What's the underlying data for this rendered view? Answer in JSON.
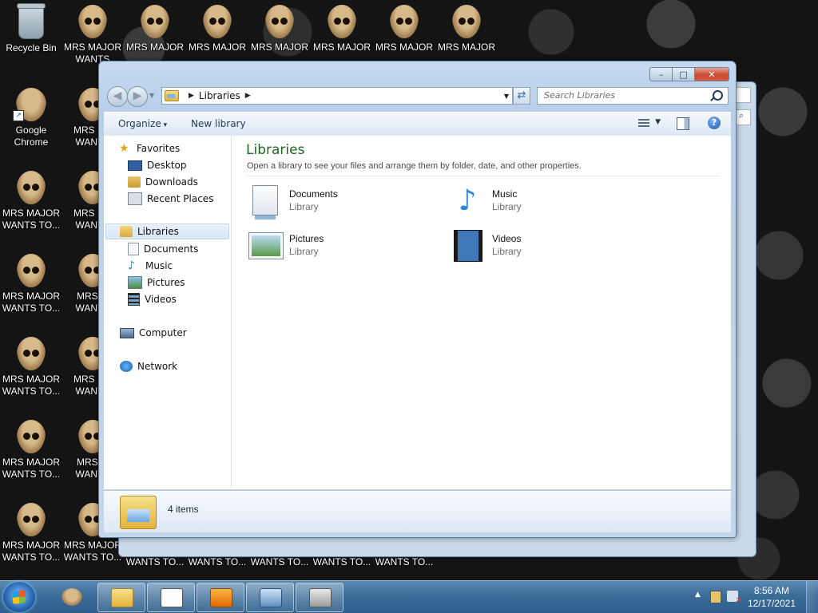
{
  "desktop": {
    "icons": [
      {
        "label": "Recycle Bin",
        "kind": "recycle-bin"
      },
      {
        "label": "MRS MAJOR WANTS...",
        "kind": "skull"
      },
      {
        "label": "MRS MAJOR",
        "kind": "skull"
      },
      {
        "label": "MRS MAJOR",
        "kind": "skull"
      },
      {
        "label": "MRS MAJOR",
        "kind": "skull"
      },
      {
        "label": "MRS MAJOR",
        "kind": "skull"
      },
      {
        "label": "MRS MAJOR",
        "kind": "skull"
      },
      {
        "label": "MRS MAJOR",
        "kind": "skull"
      },
      {
        "label": "Google Chrome",
        "kind": "chrome-shortcut"
      },
      {
        "label": "MRS MAJOR WANTS...",
        "kind": "skull"
      },
      {
        "label": "MRS MAJOR WANTS TO...",
        "kind": "skull"
      },
      {
        "label": "MRS MAJOR WANTS...",
        "kind": "skull"
      },
      {
        "label": "MRS MAJOR WANTS TO...",
        "kind": "skull"
      },
      {
        "label": "MRS MAJOR WANTS...",
        "kind": "skull"
      },
      {
        "label": "MRS MAJOR WANTS TO...",
        "kind": "skull"
      },
      {
        "label": "MRS MAJOR WANTS...",
        "kind": "skull"
      },
      {
        "label": "MRS MAJOR WANTS TO...",
        "kind": "skull"
      },
      {
        "label": "MRS MAJOR WANTS...",
        "kind": "skull"
      },
      {
        "label": "MRS MAJOR WANTS TO...",
        "kind": "skull"
      },
      {
        "label": "MRS MAJOR WANTS TO...",
        "kind": "skull"
      },
      {
        "label": "WANTS TO...",
        "kind": "label-only"
      },
      {
        "label": "WANTS TO...",
        "kind": "label-only"
      },
      {
        "label": "WANTS TO...",
        "kind": "label-only"
      },
      {
        "label": "WANTS TO...",
        "kind": "label-only"
      },
      {
        "label": "WANTS TO...",
        "kind": "label-only"
      },
      {
        "label": "WANTS TO...",
        "kind": "label-only"
      }
    ]
  },
  "window": {
    "address": {
      "crumb": "Libraries"
    },
    "search": {
      "placeholder": "Search Libraries"
    },
    "toolbar": {
      "organize": "Organize",
      "new_library": "New library",
      "help": "?"
    },
    "caption": {
      "minimize": "–",
      "maximize": "□",
      "close": "✕"
    },
    "nav": {
      "back": "◀",
      "forward": "▶",
      "favorites": "Favorites",
      "desktop": "Desktop",
      "downloads": "Downloads",
      "recent_places": "Recent Places",
      "libraries": "Libraries",
      "documents": "Documents",
      "music": "Music",
      "pictures": "Pictures",
      "videos": "Videos",
      "computer": "Computer",
      "network": "Network"
    },
    "main": {
      "title": "Libraries",
      "subtitle": "Open a library to see your files and arrange them by folder, date, and other properties.",
      "libraries": [
        {
          "name": "Documents",
          "kind": "Library"
        },
        {
          "name": "Music",
          "kind": "Library"
        },
        {
          "name": "Pictures",
          "kind": "Library"
        },
        {
          "name": "Videos",
          "kind": "Library"
        }
      ]
    },
    "details": {
      "count": "4 items"
    }
  },
  "taskbar": {
    "time": "8:56 AM",
    "date": "12/17/2021"
  }
}
